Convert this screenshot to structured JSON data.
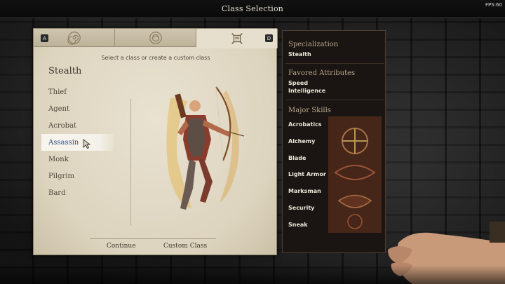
{
  "window": {
    "title": "Class Selection",
    "fps": "FPS:60"
  },
  "tabs": {
    "left_key": "A",
    "right_key": "D",
    "items": [
      {
        "icon": "spiral-emblem-icon"
      },
      {
        "icon": "circle-emblem-icon"
      },
      {
        "icon": "skull-crest-icon"
      }
    ]
  },
  "panel": {
    "subtitle": "Select a class or create a custom class",
    "heading": "Stealth",
    "classes": [
      "Thief",
      "Agent",
      "Acrobat",
      "Assassin",
      "Monk",
      "Pilgrim",
      "Bard"
    ],
    "selected_class": "Assassin",
    "continue_label": "Continue",
    "custom_label": "Custom Class"
  },
  "info": {
    "specialization_title": "Specialization",
    "specialization_value": "Stealth",
    "attributes_title": "Favored Attributes",
    "attributes": [
      "Speed",
      "Intelligence"
    ],
    "skills_title": "Major Skills",
    "skills": [
      "Acrobatics",
      "Alchemy",
      "Blade",
      "Light Armor",
      "Marksman",
      "Security",
      "Sneak"
    ]
  },
  "colors": {
    "parchment": "#e6dfcd",
    "selected_text": "#2d4e7a",
    "info_bg": "#1a1512",
    "info_title": "#b9a78c"
  }
}
